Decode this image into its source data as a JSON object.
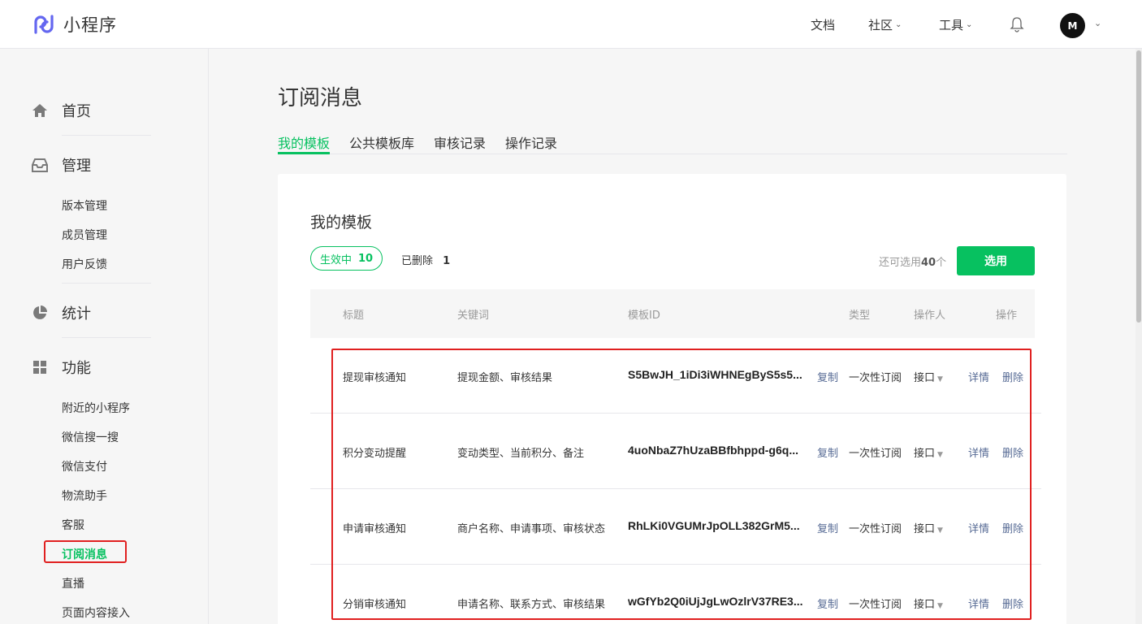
{
  "header": {
    "logo_text": "小程序",
    "nav": {
      "docs": "文档",
      "community": "社区",
      "tools": "工具"
    },
    "avatar_text": "M"
  },
  "sidebar": {
    "home": "首页",
    "manage": "管理",
    "manage_items": [
      "版本管理",
      "成员管理",
      "用户反馈"
    ],
    "stats": "统计",
    "features": "功能",
    "feature_items": [
      "附近的小程序",
      "微信搜一搜",
      "微信支付",
      "物流助手",
      "客服",
      "订阅消息",
      "直播",
      "页面内容接入"
    ],
    "active_item": "订阅消息"
  },
  "main": {
    "title": "订阅消息",
    "tabs": [
      "我的模板",
      "公共模板库",
      "审核记录",
      "操作记录"
    ],
    "active_tab": "我的模板"
  },
  "card": {
    "title": "我的模板",
    "active_label": "生效中",
    "active_count": "10",
    "deleted_label": "已删除",
    "deleted_count": "1",
    "remaining_prefix": "还可选用",
    "remaining_count": "40",
    "remaining_suffix": "个",
    "select_button": "选用"
  },
  "table": {
    "columns": [
      "标题",
      "关键词",
      "模板ID",
      "类型",
      "操作人",
      "操作"
    ],
    "rows": [
      {
        "title": "提现审核通知",
        "keywords": "提现金额、审核结果",
        "template_id": "S5BwJH_1iDi3iWHNEgByS5s5...",
        "copy": "复制",
        "type": "一次性订阅",
        "operator": "接口",
        "detail": "详情",
        "delete": "删除"
      },
      {
        "title": "积分变动提醒",
        "keywords": "变动类型、当前积分、备注",
        "template_id": "4uoNbaZ7hUzaBBfbhppd-g6q...",
        "copy": "复制",
        "type": "一次性订阅",
        "operator": "接口",
        "detail": "详情",
        "delete": "删除"
      },
      {
        "title": "申请审核通知",
        "keywords": "商户名称、申请事项、审核状态",
        "template_id": "RhLKi0VGUMrJpOLL382GrM5...",
        "copy": "复制",
        "type": "一次性订阅",
        "operator": "接口",
        "detail": "详情",
        "delete": "删除"
      },
      {
        "title": "分销审核通知",
        "keywords": "申请名称、联系方式、审核结果",
        "template_id": "wGfYb2Q0iUjJgLwOzlrV37RE3...",
        "copy": "复制",
        "type": "一次性订阅",
        "operator": "接口",
        "detail": "详情",
        "delete": "删除"
      }
    ]
  },
  "colors": {
    "accent": "#07c160",
    "link": "#576b95",
    "highlight": "#e02020"
  }
}
